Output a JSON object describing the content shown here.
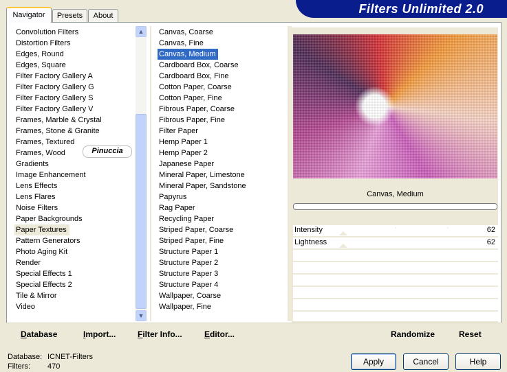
{
  "window": {
    "title": "Filters Unlimited 2.0"
  },
  "tabs": [
    {
      "label": "Navigator"
    },
    {
      "label": "Presets"
    },
    {
      "label": "About"
    }
  ],
  "categories": [
    "Convolution Filters",
    "Distortion Filters",
    "Edges, Round",
    "Edges, Square",
    "Filter Factory Gallery A",
    "Filter Factory Gallery G",
    "Filter Factory Gallery S",
    "Filter Factory Gallery V",
    "Frames, Marble & Crystal",
    "Frames, Stone & Granite",
    "Frames, Textured",
    "Frames, Wood",
    "Gradients",
    "Image Enhancement",
    "Lens Effects",
    "Lens Flares",
    "Noise Filters",
    "Paper Backgrounds",
    "Paper Textures",
    "Pattern Generators",
    "Photo Aging Kit",
    "Render",
    "Special Effects 1",
    "Special Effects 2",
    "Tile & Mirror",
    "Video"
  ],
  "selected_category": "Paper Textures",
  "filters": [
    "Canvas, Coarse",
    "Canvas, Fine",
    "Canvas, Medium",
    "Cardboard Box, Coarse",
    "Cardboard Box, Fine",
    "Cotton Paper, Coarse",
    "Cotton Paper, Fine",
    "Fibrous Paper, Coarse",
    "Fibrous Paper, Fine",
    "Filter Paper",
    "Hemp Paper 1",
    "Hemp Paper 2",
    "Japanese Paper",
    "Mineral Paper, Limestone",
    "Mineral Paper, Sandstone",
    "Papyrus",
    "Rag Paper",
    "Recycling Paper",
    "Striped Paper, Coarse",
    "Striped Paper, Fine",
    "Structure Paper 1",
    "Structure Paper 2",
    "Structure Paper 3",
    "Structure Paper 4",
    "Wallpaper, Coarse",
    "Wallpaper, Fine"
  ],
  "selected_filter": "Canvas, Medium",
  "watermark": "Pinuccia",
  "preview": {
    "filter_name": "Canvas, Medium"
  },
  "parameters": [
    {
      "label": "Intensity",
      "value": "62"
    },
    {
      "label": "Lightness",
      "value": "62"
    }
  ],
  "actions": {
    "database": "Database",
    "import": "Import...",
    "filter_info": "Filter Info...",
    "editor": "Editor...",
    "randomize": "Randomize",
    "reset": "Reset"
  },
  "status": {
    "database_label": "Database:",
    "database_value": "ICNET-Filters",
    "filters_label": "Filters:",
    "filters_value": "470"
  },
  "dialog_buttons": {
    "apply": "Apply",
    "cancel": "Cancel",
    "help": "Help"
  },
  "colors": {
    "banner": "#0a1d8c",
    "selection": "#316ac5",
    "window_bg": "#ece9d8"
  }
}
